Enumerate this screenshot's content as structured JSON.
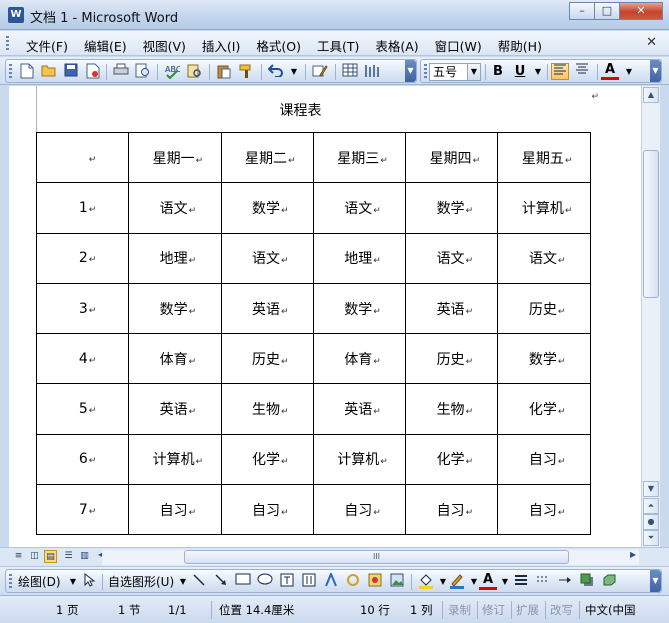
{
  "window": {
    "title": "文档 1 - Microsoft Word",
    "app_icon_letter": "W",
    "minimize_glyph": "–",
    "maximize_glyph": "□",
    "close_glyph": "✕"
  },
  "menu": {
    "items": [
      "文件(F)",
      "编辑(E)",
      "视图(V)",
      "插入(I)",
      "格式(O)",
      "工具(T)",
      "表格(A)",
      "窗口(W)",
      "帮助(H)"
    ],
    "close_doc_glyph": "✕"
  },
  "toolbar": {
    "font_size": "五号",
    "bold": "B",
    "underline": "U",
    "font_color_label": "A",
    "icons": [
      "new-document-icon",
      "open-folder-icon",
      "save-icon",
      "permission-icon",
      "print-icon",
      "print-preview-icon",
      "spelling-icon",
      "research-icon",
      "paste-icon",
      "format-painter-icon",
      "undo-icon",
      "insert-table-icon",
      "columns-icon",
      "drawing-icon"
    ]
  },
  "document": {
    "heading": "课程表",
    "header_row": [
      "",
      "星期一",
      "星期二",
      "星期三",
      "星期四",
      "星期五"
    ],
    "rows": [
      [
        "1",
        "语文",
        "数学",
        "语文",
        "数学",
        "计算机"
      ],
      [
        "2",
        "地理",
        "语文",
        "地理",
        "语文",
        "语文"
      ],
      [
        "3",
        "数学",
        "英语",
        "数学",
        "英语",
        "历史"
      ],
      [
        "4",
        "体育",
        "历史",
        "体育",
        "历史",
        "数学"
      ],
      [
        "5",
        "英语",
        "生物",
        "英语",
        "生物",
        "化学"
      ],
      [
        "6",
        "计算机",
        "化学",
        "计算机",
        "化学",
        "自习"
      ],
      [
        "7",
        "自习",
        "自习",
        "自习",
        "自习",
        "自习"
      ]
    ],
    "cell_end_mark": "↵",
    "paragraph_mark": "↵"
  },
  "hscroll": {
    "thumb_grip": "III"
  },
  "drawing": {
    "draw_menu": "绘图(D)",
    "autoshapes_menu": "自选图形(U)"
  },
  "status": {
    "page": "1 页",
    "section": "1 节",
    "page_of": "1/1",
    "position": "位置 14.4厘米",
    "line": "10 行",
    "column": "1 列",
    "rec": "录制",
    "trk": "修订",
    "ext": "扩展",
    "ovr": "改写",
    "language": "中文(中国"
  },
  "colors": {
    "accent": "#2b579a",
    "active_button": "#fbd98a",
    "close_button": "#c5442a"
  }
}
